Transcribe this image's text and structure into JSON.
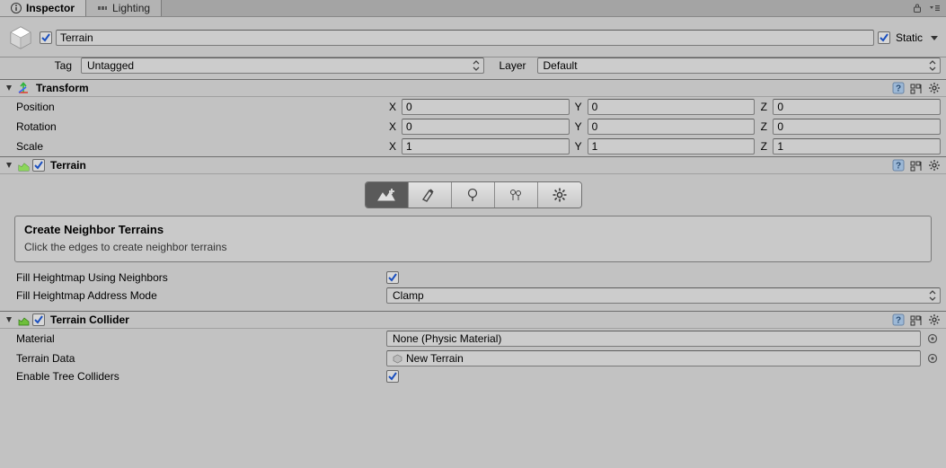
{
  "tabs": {
    "inspector": "Inspector",
    "lighting": "Lighting"
  },
  "header": {
    "active_checked": true,
    "name": "Terrain",
    "static_checked": true,
    "static_label": "Static"
  },
  "tag_layer": {
    "tag_label": "Tag",
    "tag_value": "Untagged",
    "layer_label": "Layer",
    "layer_value": "Default"
  },
  "transform": {
    "title": "Transform",
    "rows": [
      {
        "label": "Position",
        "x": "0",
        "y": "0",
        "z": "0"
      },
      {
        "label": "Rotation",
        "x": "0",
        "y": "0",
        "z": "0"
      },
      {
        "label": "Scale",
        "x": "1",
        "y": "1",
        "z": "1"
      }
    ],
    "axes": {
      "x": "X",
      "y": "Y",
      "z": "Z"
    }
  },
  "terrain": {
    "title": "Terrain",
    "enabled": true,
    "info_title": "Create Neighbor Terrains",
    "info_desc": "Click the edges to create neighbor terrains",
    "fill_using_neighbors_label": "Fill Heightmap Using Neighbors",
    "fill_using_neighbors_checked": true,
    "address_mode_label": "Fill Heightmap Address Mode",
    "address_mode_value": "Clamp"
  },
  "collider": {
    "title": "Terrain Collider",
    "enabled": true,
    "material_label": "Material",
    "material_value": "None (Physic Material)",
    "terrain_data_label": "Terrain Data",
    "terrain_data_value": "New Terrain",
    "enable_tree_label": "Enable Tree Colliders",
    "enable_tree_checked": true
  }
}
